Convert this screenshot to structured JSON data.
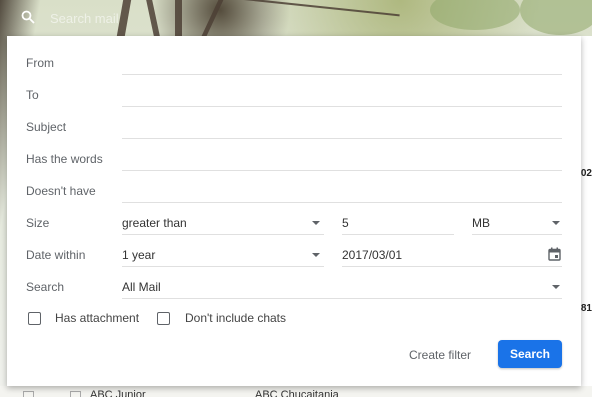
{
  "search": {
    "placeholder": "Search mail"
  },
  "dialog": {
    "fields": {
      "from_label": "From",
      "to_label": "To",
      "subject_label": "Subject",
      "has_words_label": "Has the words",
      "doesnt_have_label": "Doesn't have",
      "size_label": "Size",
      "date_within_label": "Date within",
      "search_label": "Search"
    },
    "size": {
      "comparator": "greater than",
      "amount": "5",
      "unit": "MB"
    },
    "date_within": {
      "range": "1 year",
      "date": "2017/03/01"
    },
    "search_scope": "All Mail",
    "checkboxes": {
      "has_attachment": "Has attachment",
      "dont_include_chats": "Don't include chats"
    },
    "actions": {
      "create_filter": "Create filter",
      "search": "Search"
    }
  },
  "background": {
    "edge_values": [
      "02",
      "81"
    ],
    "bottom_row": {
      "sender": "ABC Junior",
      "subject": "ABC Chucaitania"
    }
  },
  "colors": {
    "primary": "#1a73e8",
    "label": "#5f6368",
    "divider": "#e0e0e0"
  }
}
